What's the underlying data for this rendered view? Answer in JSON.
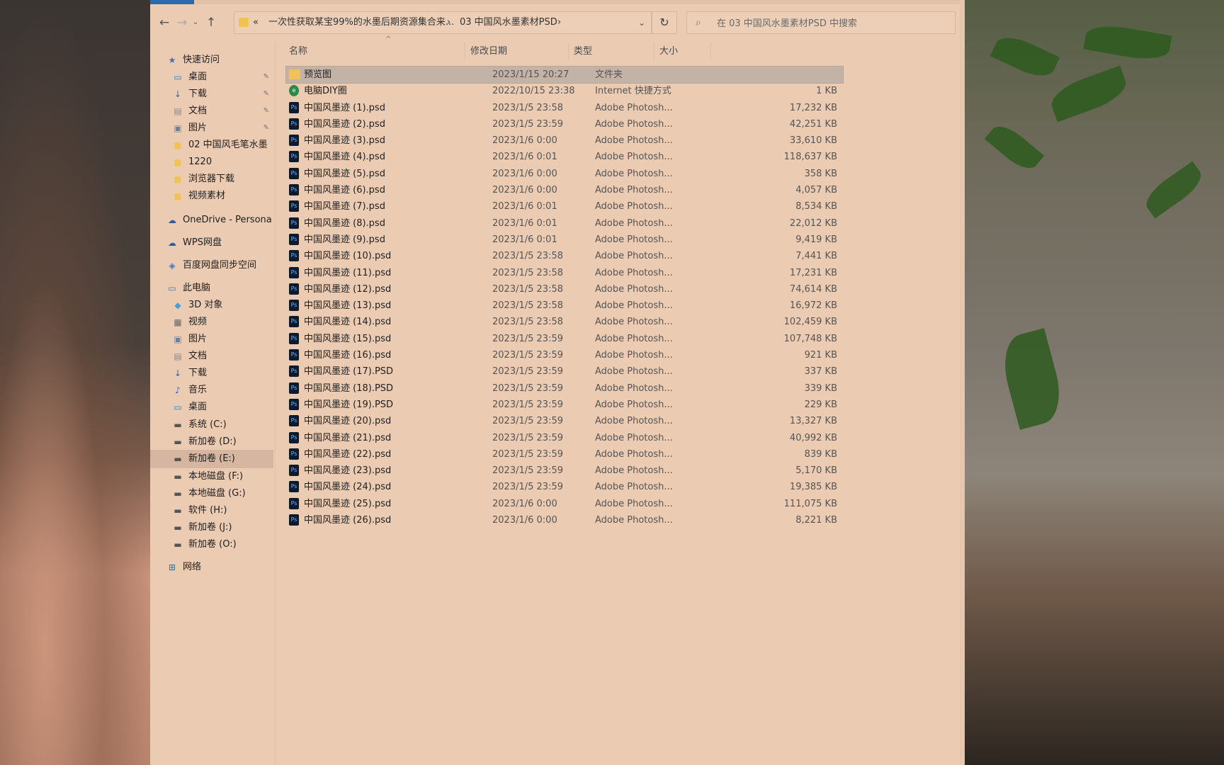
{
  "toolbar": {
    "back_icon": "arrow-left",
    "forward_icon": "arrow-right",
    "recent_icon": "chevron-down",
    "up_icon": "arrow-up",
    "address": {
      "overflow": "«",
      "crumbs": [
        "一次性获取某宝99%的水墨后期资源集合来...",
        "03 中国风水墨素材PSD"
      ],
      "separator": "›"
    },
    "search_placeholder": "在 03 中国风水墨素材PSD 中搜索"
  },
  "sidebar": {
    "items": [
      {
        "label": "快速访问",
        "icon": "star-icon",
        "pinned": false
      },
      {
        "label": "桌面",
        "icon": "desktop-icon",
        "pinned": true
      },
      {
        "label": "下载",
        "icon": "download-icon",
        "pinned": true
      },
      {
        "label": "文档",
        "icon": "document-icon",
        "pinned": true
      },
      {
        "label": "图片",
        "icon": "pictures-icon",
        "pinned": true
      },
      {
        "label": "02 中国风毛笔水墨",
        "icon": "folder-icon",
        "pinned": false
      },
      {
        "label": "1220",
        "icon": "folder-icon",
        "pinned": false
      },
      {
        "label": "浏览器下载",
        "icon": "folder-icon",
        "pinned": false
      },
      {
        "label": "视频素材",
        "icon": "folder-icon",
        "pinned": false
      },
      {
        "label": "OneDrive - Persona",
        "icon": "cloud-icon",
        "pinned": false
      },
      {
        "label": "WPS网盘",
        "icon": "cloud-icon",
        "pinned": false
      },
      {
        "label": "百度网盘同步空间",
        "icon": "sync-icon",
        "pinned": false
      },
      {
        "label": "此电脑",
        "icon": "computer-icon",
        "pinned": false
      },
      {
        "label": "3D 对象",
        "icon": "cube-icon",
        "pinned": false
      },
      {
        "label": "视频",
        "icon": "video-icon",
        "pinned": false
      },
      {
        "label": "图片",
        "icon": "pictures-icon",
        "pinned": false
      },
      {
        "label": "文档",
        "icon": "document-icon",
        "pinned": false
      },
      {
        "label": "下载",
        "icon": "download-icon",
        "pinned": false
      },
      {
        "label": "音乐",
        "icon": "music-icon",
        "pinned": false
      },
      {
        "label": "桌面",
        "icon": "desktop-icon",
        "pinned": false
      },
      {
        "label": "系统 (C:)",
        "icon": "drive-icon",
        "pinned": false
      },
      {
        "label": "新加卷 (D:)",
        "icon": "drive-icon",
        "pinned": false
      },
      {
        "label": "新加卷 (E:)",
        "icon": "drive-icon",
        "pinned": false,
        "selected": true
      },
      {
        "label": "本地磁盘 (F:)",
        "icon": "drive-icon",
        "pinned": false
      },
      {
        "label": "本地磁盘 (G:)",
        "icon": "drive-icon",
        "pinned": false
      },
      {
        "label": "软件 (H:)",
        "icon": "drive-icon",
        "pinned": false
      },
      {
        "label": "新加卷 (J:)",
        "icon": "drive-icon",
        "pinned": false
      },
      {
        "label": "新加卷 (O:)",
        "icon": "drive-icon",
        "pinned": false
      },
      {
        "label": "网络",
        "icon": "network-icon",
        "pinned": false
      }
    ]
  },
  "columns": {
    "name": "名称",
    "date": "修改日期",
    "type": "类型",
    "size": "大小"
  },
  "files": [
    {
      "name": "预览图",
      "date": "2023/1/15 20:27",
      "type": "文件夹",
      "size": "",
      "kind": "folder",
      "selected": true
    },
    {
      "name": "电脑DIY圈",
      "date": "2022/10/15 23:38",
      "type": "Internet 快捷方式",
      "size": "1 KB",
      "kind": "url"
    },
    {
      "name": "中国风墨迹 (1).psd",
      "date": "2023/1/5 23:58",
      "type": "Adobe Photosh...",
      "size": "17,232 KB",
      "kind": "ps"
    },
    {
      "name": "中国风墨迹 (2).psd",
      "date": "2023/1/5 23:59",
      "type": "Adobe Photosh...",
      "size": "42,251 KB",
      "kind": "ps"
    },
    {
      "name": "中国风墨迹 (3).psd",
      "date": "2023/1/6 0:00",
      "type": "Adobe Photosh...",
      "size": "33,610 KB",
      "kind": "ps"
    },
    {
      "name": "中国风墨迹 (4).psd",
      "date": "2023/1/6 0:01",
      "type": "Adobe Photosh...",
      "size": "118,637 KB",
      "kind": "ps"
    },
    {
      "name": "中国风墨迹 (5).psd",
      "date": "2023/1/6 0:00",
      "type": "Adobe Photosh...",
      "size": "358 KB",
      "kind": "ps"
    },
    {
      "name": "中国风墨迹 (6).psd",
      "date": "2023/1/6 0:00",
      "type": "Adobe Photosh...",
      "size": "4,057 KB",
      "kind": "ps"
    },
    {
      "name": "中国风墨迹 (7).psd",
      "date": "2023/1/6 0:01",
      "type": "Adobe Photosh...",
      "size": "8,534 KB",
      "kind": "ps"
    },
    {
      "name": "中国风墨迹 (8).psd",
      "date": "2023/1/6 0:01",
      "type": "Adobe Photosh...",
      "size": "22,012 KB",
      "kind": "ps"
    },
    {
      "name": "中国风墨迹 (9).psd",
      "date": "2023/1/6 0:01",
      "type": "Adobe Photosh...",
      "size": "9,419 KB",
      "kind": "ps"
    },
    {
      "name": "中国风墨迹 (10).psd",
      "date": "2023/1/5 23:58",
      "type": "Adobe Photosh...",
      "size": "7,441 KB",
      "kind": "ps"
    },
    {
      "name": "中国风墨迹 (11).psd",
      "date": "2023/1/5 23:58",
      "type": "Adobe Photosh...",
      "size": "17,231 KB",
      "kind": "ps"
    },
    {
      "name": "中国风墨迹 (12).psd",
      "date": "2023/1/5 23:58",
      "type": "Adobe Photosh...",
      "size": "74,614 KB",
      "kind": "ps"
    },
    {
      "name": "中国风墨迹 (13).psd",
      "date": "2023/1/5 23:58",
      "type": "Adobe Photosh...",
      "size": "16,972 KB",
      "kind": "ps"
    },
    {
      "name": "中国风墨迹 (14).psd",
      "date": "2023/1/5 23:58",
      "type": "Adobe Photosh...",
      "size": "102,459 KB",
      "kind": "ps"
    },
    {
      "name": "中国风墨迹 (15).psd",
      "date": "2023/1/5 23:59",
      "type": "Adobe Photosh...",
      "size": "107,748 KB",
      "kind": "ps"
    },
    {
      "name": "中国风墨迹 (16).psd",
      "date": "2023/1/5 23:59",
      "type": "Adobe Photosh...",
      "size": "921 KB",
      "kind": "ps"
    },
    {
      "name": "中国风墨迹 (17).PSD",
      "date": "2023/1/5 23:59",
      "type": "Adobe Photosh...",
      "size": "337 KB",
      "kind": "ps"
    },
    {
      "name": "中国风墨迹 (18).PSD",
      "date": "2023/1/5 23:59",
      "type": "Adobe Photosh...",
      "size": "339 KB",
      "kind": "ps"
    },
    {
      "name": "中国风墨迹 (19).PSD",
      "date": "2023/1/5 23:59",
      "type": "Adobe Photosh...",
      "size": "229 KB",
      "kind": "ps"
    },
    {
      "name": "中国风墨迹 (20).psd",
      "date": "2023/1/5 23:59",
      "type": "Adobe Photosh...",
      "size": "13,327 KB",
      "kind": "ps"
    },
    {
      "name": "中国风墨迹 (21).psd",
      "date": "2023/1/5 23:59",
      "type": "Adobe Photosh...",
      "size": "40,992 KB",
      "kind": "ps"
    },
    {
      "name": "中国风墨迹 (22).psd",
      "date": "2023/1/5 23:59",
      "type": "Adobe Photosh...",
      "size": "839 KB",
      "kind": "ps"
    },
    {
      "name": "中国风墨迹 (23).psd",
      "date": "2023/1/5 23:59",
      "type": "Adobe Photosh...",
      "size": "5,170 KB",
      "kind": "ps"
    },
    {
      "name": "中国风墨迹 (24).psd",
      "date": "2023/1/5 23:59",
      "type": "Adobe Photosh...",
      "size": "19,385 KB",
      "kind": "ps"
    },
    {
      "name": "中国风墨迹 (25).psd",
      "date": "2023/1/6 0:00",
      "type": "Adobe Photosh...",
      "size": "111,075 KB",
      "kind": "ps"
    },
    {
      "name": "中国风墨迹 (26).psd",
      "date": "2023/1/6 0:00",
      "type": "Adobe Photosh...",
      "size": "8,221 KB",
      "kind": "ps"
    }
  ],
  "colors": {
    "window_bg": "#ebcbb2",
    "selected_row": "#c3b2a6",
    "selected_nav": "#d6b6a0",
    "folder": "#f2c25a",
    "ps_icon": "#0c1a2e",
    "accent": "#2a6bb0"
  }
}
